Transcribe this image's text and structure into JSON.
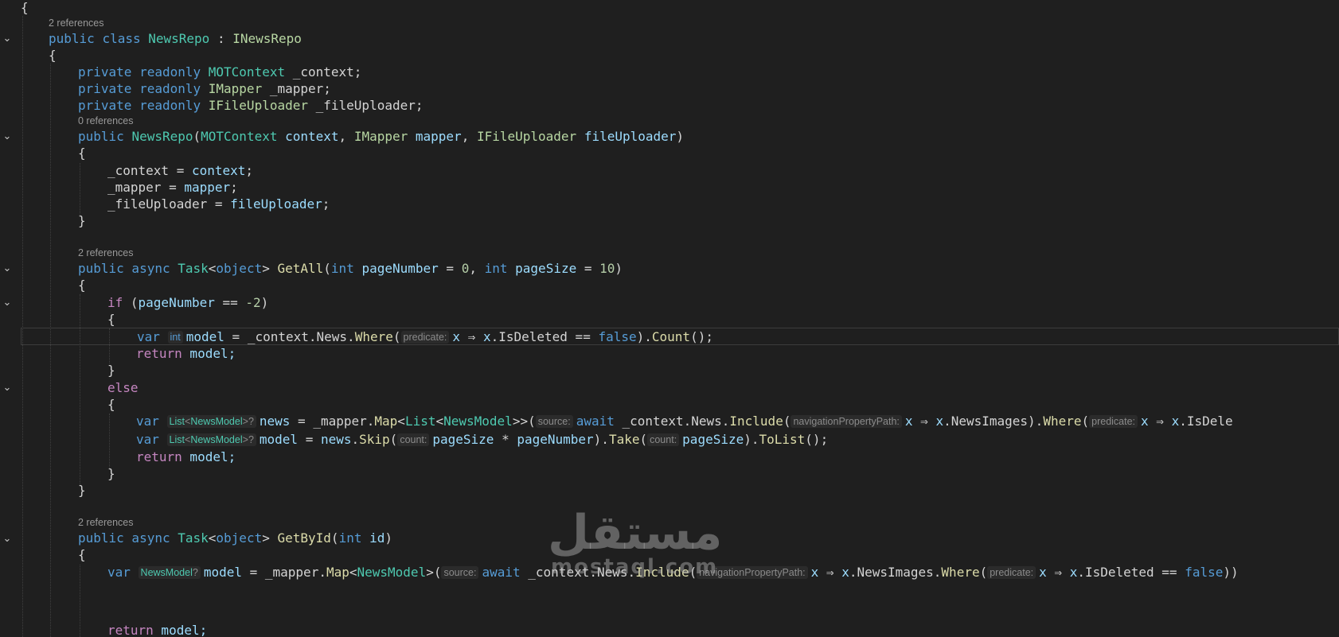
{
  "code": {
    "line_open_brace": "{",
    "refs_class": "2 references",
    "class_decl": {
      "public": "public",
      "class_kw": "class",
      "name": "NewsRepo",
      "colon": " : ",
      "iface": "INewsRepo"
    },
    "class_open": "{",
    "field1": {
      "mods": "private readonly",
      "type": "MOTContext",
      "name": " _context;"
    },
    "field2": {
      "mods": "private readonly",
      "type": "IMapper",
      "name": " _mapper;"
    },
    "field3": {
      "mods": "private readonly",
      "type": "IFileUploader",
      "name": " _fileUploader;"
    },
    "refs_ctor": "0 references",
    "ctor": {
      "public": "public",
      "name": "NewsRepo",
      "open": "(",
      "t1": "MOTContext",
      "p1": "context",
      "sep1": ", ",
      "t2": "IMapper",
      "p2": "mapper",
      "sep2": ", ",
      "t3": "IFileUploader",
      "p3": "fileUploader",
      "close": ")"
    },
    "ctor_open": "{",
    "assign1": {
      "lhs": "_context = ",
      "rhs": "context",
      "end": ";"
    },
    "assign2": {
      "lhs": "_mapper = ",
      "rhs": "mapper",
      "end": ";"
    },
    "assign3": {
      "lhs": "_fileUploader = ",
      "rhs": "fileUploader",
      "end": ";"
    },
    "ctor_close": "}",
    "refs_getall": "2 references",
    "getall": {
      "mods": "public async",
      "task": "Task",
      "lt": "<",
      "obj": "object",
      "gt": ">",
      "name": "GetAll",
      "open": "(",
      "int1": "int",
      "p1": "pageNumber",
      "eq1": " = ",
      "v1": "0",
      "sep": ", ",
      "int2": "int",
      "p2": "pageSize",
      "eq2": " = ",
      "v2": "10",
      "close": ")"
    },
    "getall_open": "{",
    "if_line": {
      "kw": "if",
      "open": " (",
      "var": "pageNumber",
      "op": " == ",
      "val": "-2",
      "close": ")"
    },
    "if_open": "{",
    "count_line": {
      "var": "var",
      "hint_type": "int",
      "name": "model",
      "eq": " = ",
      "ctx": "_context.News.",
      "where": "Where",
      "open": "(",
      "hint": "predicate:",
      "x": "x",
      "arrow": " ⇒ ",
      "x2": "x",
      "prop": ".IsDeleted == ",
      "false": "false",
      "close": ").",
      "count": "Count",
      "end": "();"
    },
    "return1": {
      "kw": "return",
      "val": " model;"
    },
    "if_close": "}",
    "else_kw": "else",
    "else_open": "{",
    "news_line": {
      "var": "var",
      "hint_list": "List",
      "hint_model": "NewsModel",
      "hint_q": "?",
      "name": "news",
      "eq": " = ",
      "mapper": "_mapper.",
      "map": "Map",
      "lt": "<",
      "list": "List",
      "lt2": "<",
      "model": "NewsModel",
      "gt": ">>(",
      "hint_source": "source:",
      "await": "await",
      "ctx": " _context.News.",
      "include": "Include",
      "open": "(",
      "hint_nav": "navigationPropertyPath:",
      "x": "x",
      "arrow": " ⇒ ",
      "x2": "x",
      "prop": ".NewsImages).",
      "where": "Where",
      "open2": "(",
      "hint_pred": "predicate:",
      "x3": "x",
      "arrow2": " ⇒ ",
      "x4": "x",
      "tail": ".IsDele"
    },
    "model_line": {
      "var": "var",
      "hint_list": "List",
      "hint_model": "NewsModel",
      "hint_q": "?",
      "name": "model",
      "eq": " = ",
      "news": "news",
      "dot": ".",
      "skip": "Skip",
      "open": "(",
      "hint_count": "count:",
      "p1": "pageSize",
      "mul": " * ",
      "p2": "pageNumber",
      "close": ").",
      "take": "Take",
      "open2": "(",
      "hint_count2": "count:",
      "p3": "pageSize",
      "close2": ").",
      "tolist": "ToList",
      "end": "();"
    },
    "return2": {
      "kw": "return",
      "val": " model;"
    },
    "else_close": "}",
    "getall_close": "}",
    "refs_getbyid": "2 references",
    "getbyid": {
      "mods": "public async",
      "task": "Task",
      "lt": "<",
      "obj": "object",
      "gt": ">",
      "name": "GetById",
      "open": "(",
      "int": "int",
      "p": "id",
      "close": ")"
    },
    "getbyid_open": "{",
    "byid_line": {
      "var": "var",
      "hint_model": "NewsModel",
      "hint_q": "?",
      "name": "model",
      "eq": " = ",
      "mapper": "_mapper.",
      "map": "Map",
      "lt": "<",
      "model": "NewsModel",
      "gt": ">(",
      "hint_source": "source:",
      "await": "await",
      "ctx": " _context.News.",
      "include": "Include",
      "open": "(",
      "hint_nav": "navigationPropertyPath:",
      "x": "x",
      "arrow": " ⇒ ",
      "x2": "x",
      "prop": ".NewsImages.",
      "where": "Where",
      "open2": "(",
      "hint_pred": "predicate:",
      "x3": "x",
      "arrow2": " ⇒ ",
      "x4": "x",
      "prop2": ".IsDeleted == ",
      "false": "false",
      "tail": "))"
    },
    "return3": {
      "kw": "return",
      "val": " model;"
    }
  },
  "watermark": {
    "arabic": "مستقل",
    "latin": "mostaql.com"
  }
}
